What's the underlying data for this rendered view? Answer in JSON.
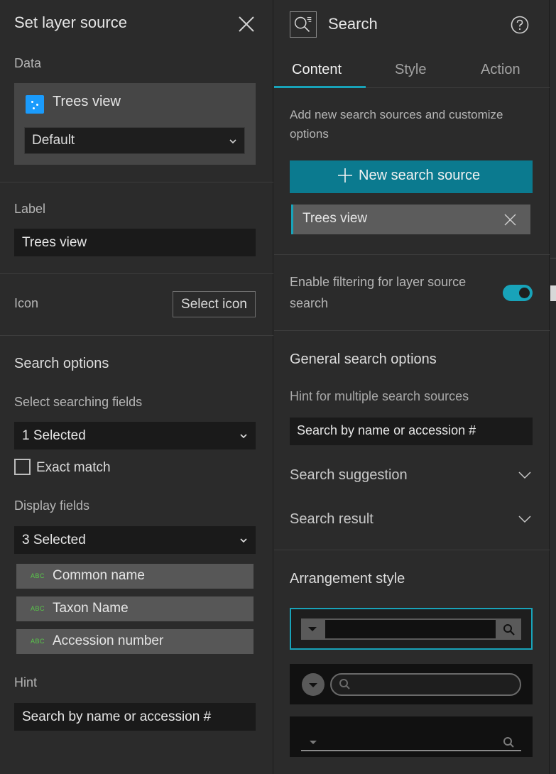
{
  "left_panel": {
    "title": "Set layer source",
    "data_label": "Data",
    "layer_name": "Trees view",
    "view_select": "Default",
    "label_heading": "Label",
    "label_value": "Trees view",
    "icon_heading": "Icon",
    "select_icon_button": "Select icon",
    "search_options_heading": "Search options",
    "searching_fields_label": "Select searching fields",
    "searching_fields_value": "1 Selected",
    "exact_match_label": "Exact match",
    "display_fields_label": "Display fields",
    "display_fields_value": "3 Selected",
    "display_fields": [
      {
        "type": "ABC",
        "name": "Common name"
      },
      {
        "type": "ABC",
        "name": "Taxon Name"
      },
      {
        "type": "ABC",
        "name": "Accession number"
      }
    ],
    "hint_label": "Hint",
    "hint_value": "Search by name or accession #"
  },
  "right_panel": {
    "title": "Search",
    "tabs": [
      {
        "label": "Content",
        "active": true
      },
      {
        "label": "Style",
        "active": false
      },
      {
        "label": "Action",
        "active": false
      }
    ],
    "description": "Add new search sources and customize options",
    "new_source_button": "New search source",
    "sources": [
      {
        "name": "Trees view"
      }
    ],
    "enable_filtering_label": "Enable filtering for layer source search",
    "enable_filtering_on": true,
    "general_options_heading": "General search options",
    "hint_multiple_label": "Hint for multiple search sources",
    "hint_multiple_value": "Search by name or accession #",
    "search_suggestion": "Search suggestion",
    "search_result": "Search result",
    "arrangement_heading": "Arrangement style",
    "arrangement_selected_index": 0
  },
  "colors": {
    "accent": "#18a3b9",
    "primary_button": "#0b7a8f",
    "layer_icon": "#1a9bfc",
    "field_type": "#59c74a",
    "panel_bg": "#2b2b2b"
  }
}
